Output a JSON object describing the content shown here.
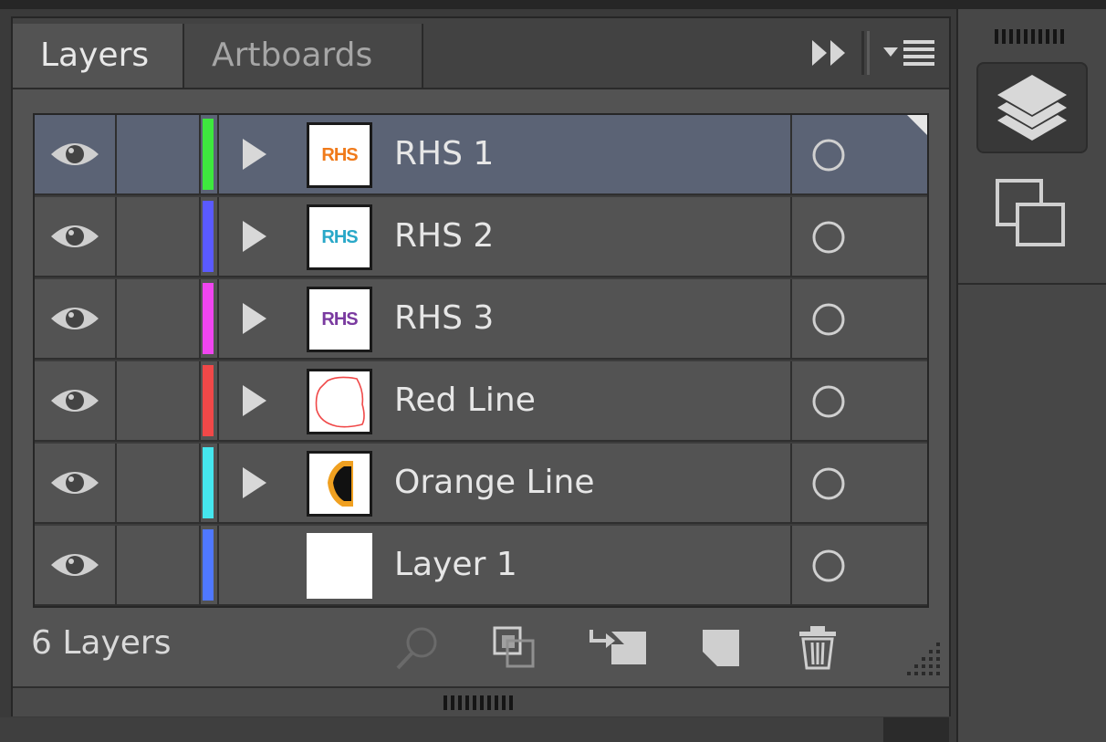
{
  "tabs": {
    "layers": "Layers",
    "artboards": "Artboards"
  },
  "layers": [
    {
      "name": "RHS 1",
      "color": "#3ee83e",
      "has_children": true,
      "selected": true,
      "thumb_text": "RHS",
      "thumb_color": "#f07a1a"
    },
    {
      "name": "RHS 2",
      "color": "#5a5aff",
      "has_children": true,
      "selected": false,
      "thumb_text": "RHS",
      "thumb_color": "#29a8c8"
    },
    {
      "name": "RHS 3",
      "color": "#f045f0",
      "has_children": true,
      "selected": false,
      "thumb_text": "RHS",
      "thumb_color": "#7a3aa0"
    },
    {
      "name": "Red Line",
      "color": "#f04848",
      "has_children": true,
      "selected": false,
      "thumb_text": "",
      "thumb_color": "#f04848"
    },
    {
      "name": "Orange Line",
      "color": "#45e6ee",
      "has_children": true,
      "selected": false,
      "thumb_text": "",
      "thumb_color": "#f0a020"
    },
    {
      "name": "Layer 1",
      "color": "#4f78ff",
      "has_children": false,
      "selected": false,
      "thumb_text": "",
      "thumb_color": "#ffffff"
    }
  ],
  "footer": {
    "count": "6 Layers"
  },
  "icons": {
    "visibility": "eye-icon",
    "expand": "triangle-right-icon",
    "target": "circle-icon",
    "locate": "search-icon",
    "clipping": "clipping-mask-icon",
    "sublayer": "new-sublayer-icon",
    "newlayer": "new-layer-icon",
    "delete": "trash-icon",
    "collapse": "double-chevron-icon",
    "menu": "panel-menu-icon",
    "dock_layers": "layers-stack-icon",
    "dock_artboards": "artboards-icon"
  }
}
